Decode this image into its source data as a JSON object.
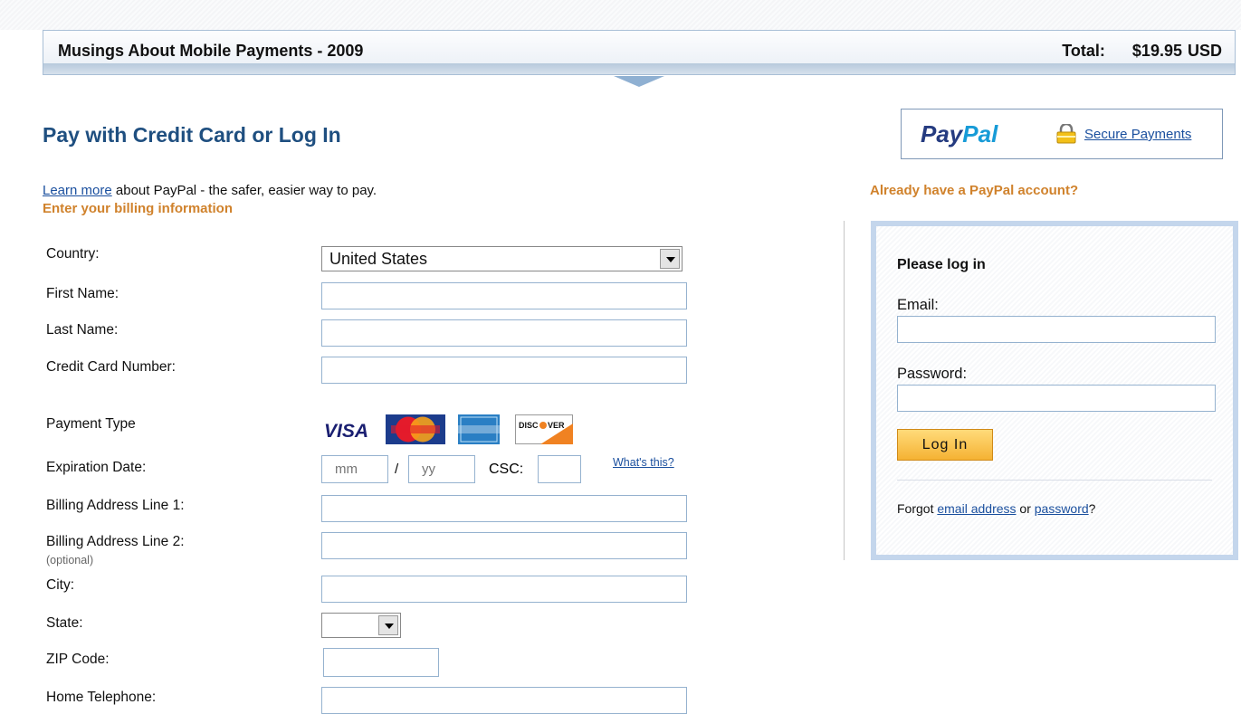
{
  "header": {
    "title": "Musings About Mobile Payments - 2009",
    "total_label": "Total:",
    "total_amount": "$19.95",
    "currency": "USD"
  },
  "page": {
    "heading": "Pay with Credit Card or Log In",
    "learn_more_link": "Learn more",
    "learn_more_text": " about PayPal - the safer, easier way to pay.",
    "billing_heading": "Enter your billing information"
  },
  "form": {
    "country_label": "Country:",
    "country_value": "United States",
    "first_name_label": "First Name:",
    "last_name_label": "Last Name:",
    "card_number_label": "Credit Card Number:",
    "payment_type_label": "Payment Type",
    "card_logos": [
      "VISA",
      "MasterCard",
      "American Express",
      "DISCOVER"
    ],
    "expiration_label": "Expiration Date:",
    "exp_month_placeholder": "mm",
    "exp_sep": "/",
    "exp_year_placeholder": "yy",
    "csc_label": "CSC:",
    "whats_this": "What's this?",
    "address1_label": "Billing Address Line 1:",
    "address2_label": "Billing Address Line 2:",
    "address2_optional": "(optional)",
    "city_label": "City:",
    "state_label": "State:",
    "state_value": "",
    "zip_label": "ZIP Code:",
    "phone_label": "Home Telephone:"
  },
  "paypal_badge": {
    "logo_part1": "Pay",
    "logo_part2": "Pal",
    "secure_link": "Secure Payments",
    "icon": "lock-icon"
  },
  "login": {
    "already_have": "Already have a PayPal account?",
    "title": "Please log in",
    "email_label": "Email:",
    "password_label": "Password:",
    "button": "Log In",
    "forgot_prefix": "Forgot ",
    "forgot_email_link": "email address",
    "forgot_or": " or ",
    "forgot_password_link": "password",
    "forgot_suffix": "?"
  },
  "colors": {
    "heading_blue": "#1f4f80",
    "accent_orange": "#d0822c",
    "link_blue": "#1a4f9e",
    "button_gold": "#f5b233"
  }
}
